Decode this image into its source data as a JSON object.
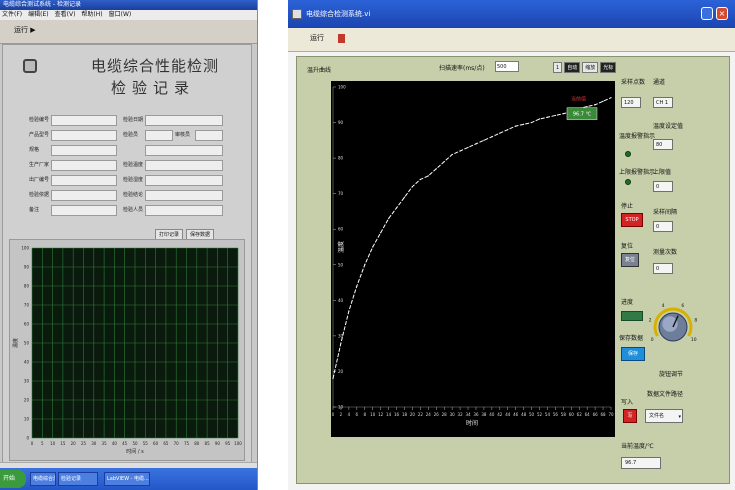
{
  "left_window": {
    "title": "电缆综合测试系统 - 检测记录",
    "menu": [
      "文件(F)",
      "编辑(E)",
      "查看(V)",
      "帮助(H)",
      "窗口(W)"
    ],
    "toolbar_label": "运行 ▶",
    "title_line1": "电缆综合性能检测",
    "title_line2": "检验记录",
    "form_rows": [
      {
        "left_label": "检验编号",
        "right_label": "检验日期",
        "right_extra": ""
      },
      {
        "left_label": "产品型号",
        "right_label": "检验员",
        "right_extra": "审核员"
      },
      {
        "left_label": "规格",
        "right_label": "",
        "right_extra": ""
      },
      {
        "left_label": "生产厂家",
        "right_label": "检验温度",
        "right_extra": ""
      },
      {
        "left_label": "出厂编号",
        "right_label": "检验湿度",
        "right_extra": ""
      },
      {
        "left_label": "检验依据",
        "right_label": "检验结论",
        "right_extra": ""
      },
      {
        "left_label": "备注",
        "right_label": "检验人员",
        "right_extra": ""
      }
    ],
    "buttons": [
      "打印记录",
      "保存数据"
    ],
    "x_axis_label": "时间 / s",
    "y_axis_label": "温度",
    "taskbar": {
      "start": "开始",
      "items": [
        "电缆综合测...",
        "检验记录",
        "LabVIEW - 电缆..."
      ]
    }
  },
  "right_window": {
    "title": "电缆综合检测系统.vi",
    "toolbar_button": "运行",
    "chart_label": "温升曲线",
    "speed_label": "扫描速率(ms/点)",
    "speed_value": "500",
    "tools": [
      "1",
      "自动",
      "缩放",
      "光标"
    ],
    "marker_label": "当前值",
    "marker_value": "96.7 ℃",
    "x_axis_label": "时间",
    "y_axis_label": "温度",
    "controls": {
      "sample_count_label": "采样点数",
      "sample_count_value": "120",
      "channel_label": "通道",
      "channel_value": "CH 1",
      "alarm1_label": "温度报警指示",
      "setpoint_label": "温度设定值",
      "setpoint_value": "80",
      "alarm2_label": "上限报警指示",
      "upper_label": "上限值",
      "upper_value": "0",
      "stop_label": "停止",
      "stop_btn": "STOP",
      "interval_label": "采样间隔",
      "interval_value": "0",
      "reset_label": "复位",
      "reset_btn": "复位",
      "count_label": "测量次数",
      "count_value": "0",
      "progress_label": "进度",
      "knob_label": "旋钮调节",
      "knob_ticks": [
        "0",
        "2",
        "4",
        "6",
        "8",
        "10"
      ],
      "knob_value": 6,
      "save_label": "保存数据",
      "save_btn": "保存",
      "write_label": "写入",
      "write_btn": "写",
      "file_label": "数据文件路径",
      "combo_value": "文件名",
      "cur_temp_label": "当前温度/℃",
      "cur_temp_value": "96.7"
    }
  },
  "chart_data": [
    {
      "type": "line",
      "title": "",
      "xlabel": "时间",
      "ylabel": "温度",
      "x": [
        0,
        2,
        4,
        6,
        8,
        10,
        12,
        14,
        16,
        18,
        20,
        22,
        24,
        26,
        28,
        30,
        32,
        34,
        36,
        38,
        40,
        42,
        44,
        46,
        48,
        50,
        52,
        54,
        56,
        58,
        60,
        62,
        64,
        66,
        68,
        70
      ],
      "series": [
        {
          "name": "",
          "values": [
            18,
            28,
            37,
            44,
            50,
            55,
            59,
            63,
            66,
            69,
            72,
            74,
            75,
            77,
            79,
            81,
            82,
            83,
            84,
            85,
            86,
            87,
            88,
            89,
            89.5,
            90,
            91,
            91.5,
            92,
            92.5,
            93,
            94,
            94.5,
            95,
            96,
            97
          ]
        }
      ],
      "xlim": [
        0,
        70
      ],
      "ylim": [
        10,
        100
      ],
      "grid": false,
      "x_ticks": [
        "0",
        "2",
        "4",
        "6",
        "8",
        "10",
        "12",
        "14",
        "16",
        "18",
        "20",
        "22",
        "24",
        "26",
        "28",
        "30",
        "32",
        "34",
        "36",
        "38",
        "40",
        "42",
        "44",
        "46",
        "48",
        "50",
        "52",
        "54",
        "56",
        "58",
        "60",
        "62",
        "64",
        "66",
        "68",
        "70"
      ],
      "y_ticks": [
        "10",
        "20",
        "30",
        "40",
        "50",
        "60",
        "70",
        "80",
        "90",
        "100"
      ]
    },
    {
      "type": "line",
      "title": "",
      "xlabel": "时间 / s",
      "ylabel": "温度",
      "x": [],
      "series": [],
      "xlim": [
        0,
        100
      ],
      "ylim": [
        0,
        100
      ],
      "grid": true,
      "x_ticks": [
        "0",
        "5",
        "10",
        "15",
        "20",
        "25",
        "30",
        "35",
        "40",
        "45",
        "50",
        "55",
        "60",
        "65",
        "70",
        "75",
        "80",
        "85",
        "90",
        "95",
        "100"
      ],
      "y_ticks": [
        "0",
        "10",
        "20",
        "30",
        "40",
        "50",
        "60",
        "70",
        "80",
        "90",
        "100"
      ]
    }
  ],
  "colors": {
    "plot_bg": "#000000",
    "trace": "#ffffff",
    "left_grid": "#2f7d3a",
    "left_plot_bg": "#0a1a0c",
    "panel": "#c6cfaa"
  }
}
